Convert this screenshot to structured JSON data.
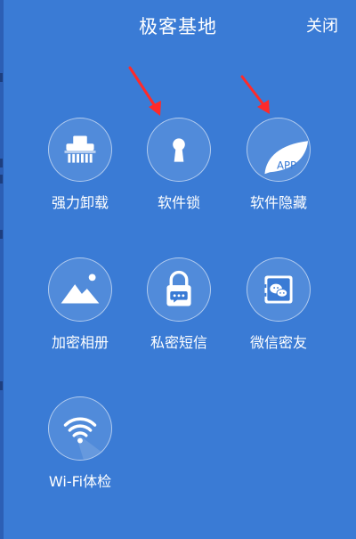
{
  "header": {
    "title": "极客基地",
    "close_label": "关闭"
  },
  "grid": {
    "items": [
      {
        "label": "强力卸载",
        "icon": "shredder-icon"
      },
      {
        "label": "软件锁",
        "icon": "keyhole-icon"
      },
      {
        "label": "软件隐藏",
        "icon": "app-leaf-icon",
        "icon_text": "APP"
      },
      {
        "label": "加密相册",
        "icon": "photo-mountain-icon"
      },
      {
        "label": "私密短信",
        "icon": "locked-message-icon"
      },
      {
        "label": "微信密友",
        "icon": "wechat-safe-icon"
      },
      {
        "label": "Wi-Fi体检",
        "icon": "wifi-icon"
      }
    ]
  },
  "colors": {
    "background": "#3a7bd5",
    "arrow": "#ff2a2a"
  }
}
